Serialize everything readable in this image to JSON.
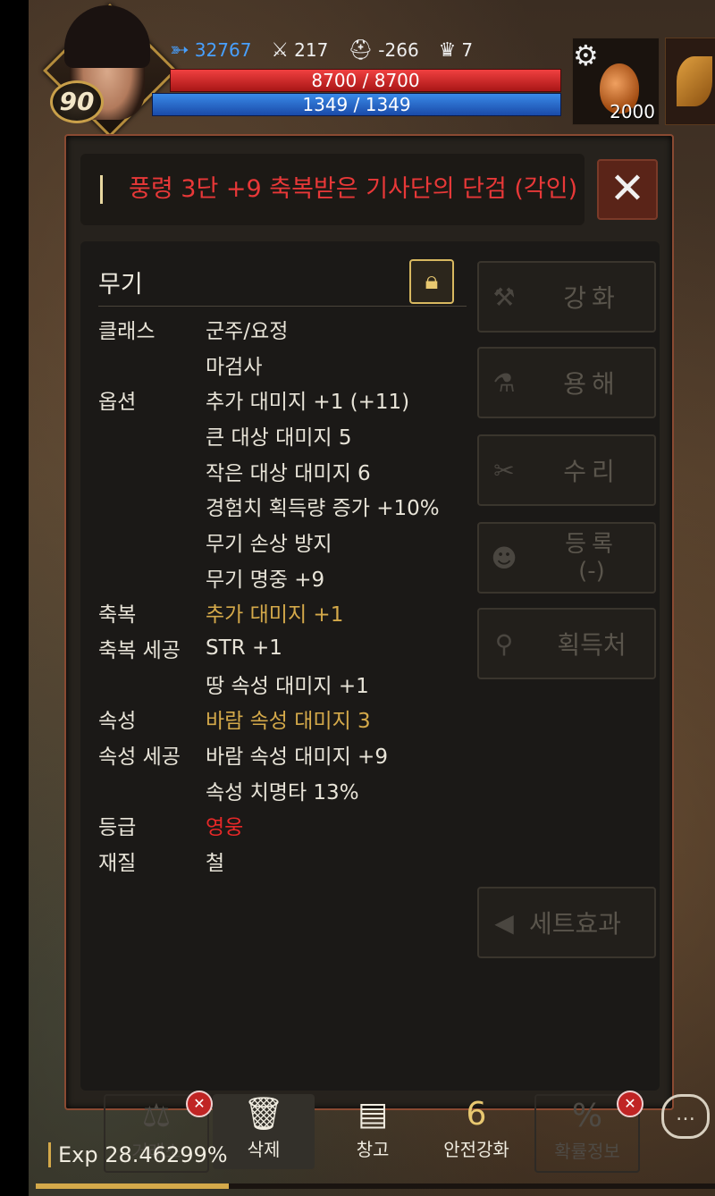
{
  "hud": {
    "level": "90",
    "stats": [
      {
        "icon": "wing-icon",
        "value": "32767"
      },
      {
        "icon": "sword-icon",
        "value": "217"
      },
      {
        "icon": "helmet-icon",
        "value": "-266"
      },
      {
        "icon": "trophy-icon",
        "value": "7"
      }
    ],
    "hp": "8700 / 8700",
    "mp": "1349 / 1349",
    "potion_count": "2000"
  },
  "item": {
    "title": "풍령 3단 +9 축복받은 기사단의 단검 (각인)",
    "category": "무기",
    "rows": [
      {
        "label": "클래스",
        "value": "군주/요정",
        "style": ""
      },
      {
        "label": "",
        "value": "마검사",
        "style": ""
      },
      {
        "label": "옵션",
        "value": "추가 대미지 +1 (+11)",
        "style": ""
      },
      {
        "label": "",
        "value": "큰 대상 대미지 5",
        "style": ""
      },
      {
        "label": "",
        "value": "작은 대상 대미지 6",
        "style": ""
      },
      {
        "label": "",
        "value": "경험치 획득량 증가 +10%",
        "style": ""
      },
      {
        "label": "",
        "value": "무기 손상 방지",
        "style": ""
      },
      {
        "label": "",
        "value": "무기 명중 +9",
        "style": ""
      },
      {
        "label": "축복",
        "value": "추가 대미지 +1",
        "style": "gold"
      },
      {
        "label": "축복 세공",
        "value": "STR +1",
        "style": ""
      },
      {
        "label": "",
        "value": "땅 속성 대미지 +1",
        "style": ""
      },
      {
        "label": "속성",
        "value": "바람 속성 대미지  3",
        "style": "gold"
      },
      {
        "label": "속성 세공",
        "value": "바람 속성 대미지 +9",
        "style": ""
      },
      {
        "label": "",
        "value": "속성 치명타 13%",
        "style": ""
      },
      {
        "label": "등급",
        "value": "영웅",
        "style": "red"
      },
      {
        "label": "재질",
        "value": "철",
        "style": ""
      }
    ]
  },
  "actions": {
    "enhance": "강화",
    "dissolve": "용해",
    "repair": "수리",
    "register": "등록",
    "register_sub": "(-)",
    "acquire": "획득처",
    "set_effect": "세트효과"
  },
  "toolbar": {
    "exchange": "거래소",
    "delete": "삭제",
    "storage": "창고",
    "safe_enhance": "안전강화",
    "safe_enhance_num": "6",
    "probability": "확률정보"
  },
  "exp": {
    "label": "Exp",
    "value": "28.46299%",
    "fraction": 0.2846
  }
}
